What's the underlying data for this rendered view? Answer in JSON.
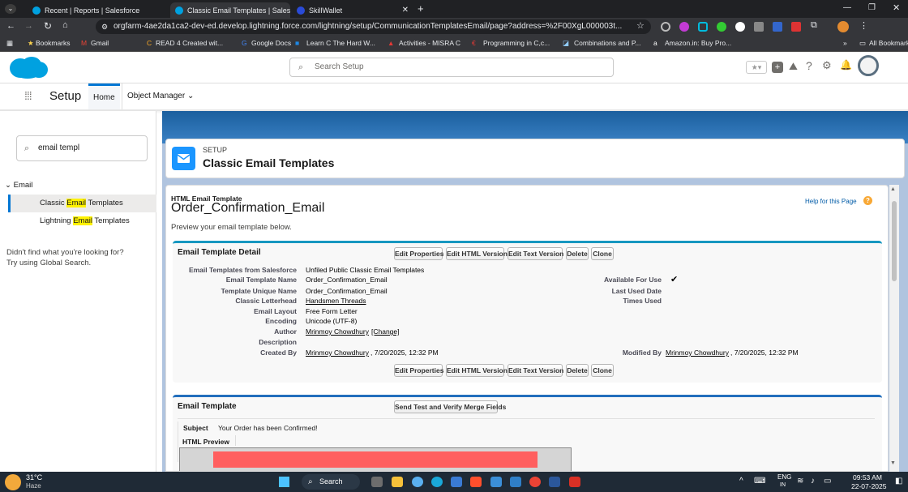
{
  "browser": {
    "tabs": [
      {
        "title": "Recent | Reports | Salesforce",
        "active": false
      },
      {
        "title": "Classic Email Templates | Salesf",
        "active": true
      },
      {
        "title": "SkillWallet",
        "active": false
      }
    ],
    "url": "orgfarm-4ae2da1ca2-dev-ed.develop.lightning.force.com/lightning/setup/CommunicationTemplatesEmail/page?address=%2F00XgL000003t...",
    "bookmarks": [
      "Bookmarks",
      "Gmail",
      "READ 4 Created wit...",
      "Google Docs",
      "Learn C The Hard W...",
      "Activities - MISRA C",
      "Programming in C,c...",
      "Combinations and P...",
      "Amazon.in: Buy Pro..."
    ],
    "all_bookmarks": "All Bookmarks"
  },
  "sf": {
    "search_placeholder": "Search Setup",
    "app_name": "Setup",
    "nav": {
      "home": "Home",
      "object_manager": "Object Manager"
    }
  },
  "left": {
    "quickfind_value": "email templ",
    "group": "Email",
    "items": [
      "Classic Email Templates",
      "Lightning Email Templates"
    ],
    "not_found_line1": "Didn't find what you're looking for?",
    "not_found_line2": "Try using Global Search."
  },
  "header": {
    "eyebrow": "SETUP",
    "title": "Classic Email Templates"
  },
  "template": {
    "type_label": "HTML Email Template",
    "name": "Order_Confirmation_Email",
    "help": "Help for this Page",
    "preview_text": "Preview your email template below.",
    "detail_title": "Email Template Detail",
    "buttons": [
      "Edit Properties",
      "Edit HTML Version",
      "Edit Text Version",
      "Delete",
      "Clone"
    ],
    "fields": [
      {
        "label": "Email Templates from Salesforce",
        "value": "Unfiled Public Classic Email Templates",
        "link": false
      },
      {
        "label": "Email Template Name",
        "value": "Order_Confirmation_Email",
        "link": false
      },
      {
        "label": "Template Unique Name",
        "value": "Order_Confirmation_Email",
        "link": false
      },
      {
        "label": "Classic Letterhead",
        "value": "Handsmen Threads",
        "link": true
      },
      {
        "label": "Email Layout",
        "value": "Free Form Letter",
        "link": false
      },
      {
        "label": "Encoding",
        "value": "Unicode (UTF-8)",
        "link": false
      },
      {
        "label": "Author",
        "value": "Mrinmoy Chowdhury",
        "link": true
      },
      {
        "label": "Description",
        "value": "",
        "link": false
      },
      {
        "label": "Created By",
        "value": "Mrinmoy Chowdhury",
        "link": true
      }
    ],
    "author_change": "[Change]",
    "created_date": ", 7/20/2025, 12:32 PM",
    "right_fields": [
      {
        "label": "Available For Use",
        "value": "✔"
      },
      {
        "label": "Last Used Date",
        "value": ""
      },
      {
        "label": "Times Used",
        "value": ""
      }
    ],
    "modified_label": "Modified By",
    "modified_by": "Mrinmoy Chowdhury",
    "modified_date": ", 7/20/2025, 12:32 PM",
    "email_section_title": "Email Template",
    "send_test_button": "Send Test and Verify Merge Fields",
    "subject_label": "Subject",
    "subject_value": "Your Order has been Confirmed!",
    "html_preview_label": "HTML Preview"
  },
  "taskbar": {
    "weather_temp": "31°C",
    "weather_desc": "Haze",
    "search": "Search",
    "lang": "ENG",
    "lang_sub": "IN",
    "time": "09:53 AM",
    "date": "22-07-2025"
  },
  "colors": {
    "accent": "#1b96ff",
    "brand": "#00a1e0",
    "highlight": "#fff200",
    "preview_bar": "#ff5f5f"
  }
}
